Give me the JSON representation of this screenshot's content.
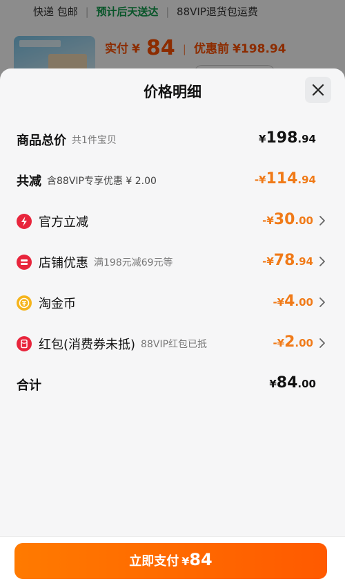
{
  "background": {
    "shipping": "快递 包邮",
    "delivery": "预计后天送达",
    "return_policy": "88VIP退货包运费",
    "paid_label": "实付",
    "paid_currency": "¥",
    "paid_amount": "84",
    "original_label": "优惠前",
    "original_price": "¥198.94"
  },
  "sheet": {
    "title": "价格明细",
    "close_icon": "close-icon",
    "total_price": {
      "label": "商品总价",
      "note": "共1件宝贝",
      "currency": "¥",
      "integer": "198",
      "decimal": ".94"
    },
    "total_discount": {
      "label": "共减",
      "note": "含88VIP专享优惠 ¥ 2.00",
      "prefix": "-¥",
      "integer": "114",
      "decimal": ".94"
    },
    "items": [
      {
        "icon": "lightning-icon",
        "label": "官方立减",
        "note": "",
        "prefix": "-¥",
        "integer": "30",
        "decimal": ".00"
      },
      {
        "icon": "shop-coupon-icon",
        "label": "店铺优惠",
        "note": "满198元减69元等",
        "prefix": "-¥",
        "integer": "78",
        "decimal": ".94"
      },
      {
        "icon": "gold-coin-icon",
        "label": "淘金币",
        "note": "",
        "prefix": "-¥",
        "integer": "4",
        "decimal": ".00"
      },
      {
        "icon": "red-packet-icon",
        "label": "红包(消费券未抵)",
        "note": "88VIP红包已抵",
        "prefix": "-¥",
        "integer": "2",
        "decimal": ".00"
      }
    ],
    "sum": {
      "label": "合计",
      "currency": "¥",
      "integer": "84",
      "decimal": ".00"
    }
  },
  "pay_button": {
    "label": "立即支付",
    "currency": "¥",
    "amount": "84"
  },
  "colors": {
    "accent": "#ff5000",
    "discount": "#f07a18",
    "icon_red": "#e8253c",
    "icon_gold": "#f5b41c"
  }
}
